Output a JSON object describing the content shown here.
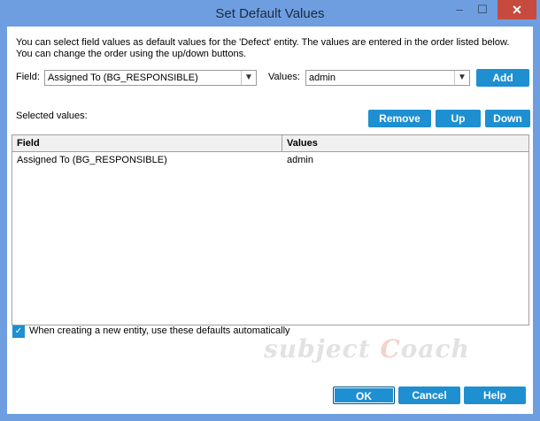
{
  "window": {
    "title": "Set Default Values",
    "minimize": "–",
    "maximize": "☐",
    "close": "✕"
  },
  "info": {
    "line1": "You can select field values as default values for the 'Defect' entity. The values are entered in the order listed below.",
    "line2": "You can change the order using the up/down buttons."
  },
  "field": {
    "label": "Field:",
    "value": "Assigned To (BG_RESPONSIBLE)"
  },
  "values": {
    "label": "Values:",
    "value": "admin"
  },
  "buttons": {
    "add": "Add",
    "remove": "Remove",
    "up": "Up",
    "down": "Down",
    "ok": "OK",
    "cancel": "Cancel",
    "help": "Help"
  },
  "selected_label": "Selected values:",
  "grid": {
    "headers": [
      "Field",
      "Values"
    ],
    "rows": [
      {
        "field": "Assigned To (BG_RESPONSIBLE)",
        "value": "admin"
      }
    ]
  },
  "auto_default": {
    "checked": true,
    "label": "When creating a new entity, use these defaults automatically"
  },
  "watermark": {
    "part1": "subject ",
    "part2": "C",
    "part3": "oach"
  },
  "colors": {
    "accent": "#1e8fd0",
    "titlebar": "#6f9ee0",
    "close": "#c74a3e"
  }
}
